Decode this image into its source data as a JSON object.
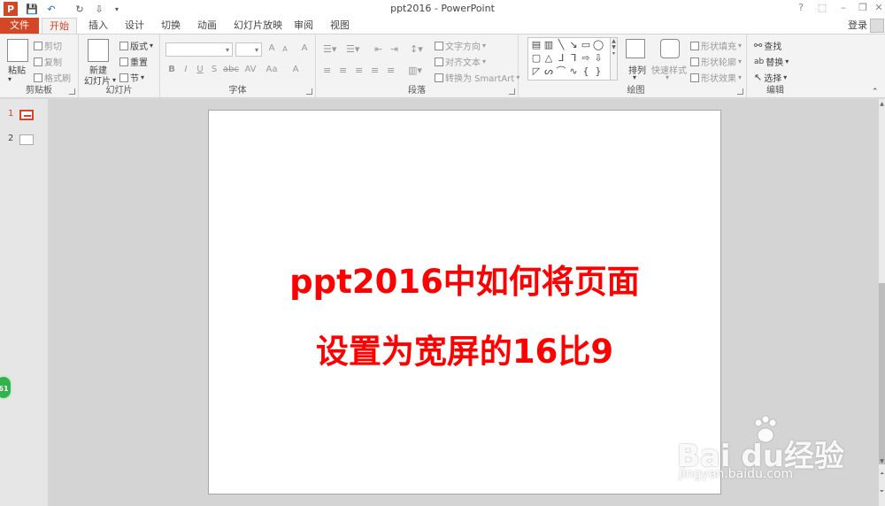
{
  "window": {
    "title": "ppt2016 - PowerPoint",
    "help": "?",
    "minimize": "–",
    "restore": "❐",
    "close": "✕"
  },
  "quick_access": {
    "app_icon": "P",
    "save": "💾",
    "undo": "↶",
    "redo": "↻",
    "more": "⇩"
  },
  "tabs": {
    "file": "文件",
    "items": [
      "开始",
      "插入",
      "设计",
      "切换",
      "动画",
      "幻灯片放映",
      "审阅",
      "视图"
    ],
    "login": "登录"
  },
  "ribbon": {
    "clipboard": {
      "label": "剪贴板",
      "paste": "粘贴",
      "cut": "剪切",
      "copy": "复制",
      "format_painter": "格式刷"
    },
    "slides": {
      "label": "幻灯片",
      "new_slide_1": "新建",
      "new_slide_2": "幻灯片",
      "layout": "版式",
      "reset": "重置",
      "section": "节"
    },
    "font": {
      "label": "字体",
      "bold": "B",
      "italic": "I",
      "underline": "U",
      "shadow": "S",
      "strike": "abc",
      "spacing": "AV",
      "case": "Aa",
      "grow": "A",
      "shrink": "A",
      "clear": "A",
      "color": "A"
    },
    "paragraph": {
      "label": "段落",
      "text_direction": "文字方向",
      "align_text": "对齐文本",
      "convert_smartart": "转换为 SmartArt"
    },
    "drawing": {
      "label": "绘图",
      "arrange": "排列",
      "quick_styles": "快速样式",
      "shape_fill": "形状填充",
      "shape_outline": "形状轮廓",
      "shape_effects": "形状效果"
    },
    "editing": {
      "label": "编辑",
      "find": "查找",
      "replace": "替换",
      "select": "选择"
    }
  },
  "thumbnails": [
    {
      "number": "1",
      "selected": true
    },
    {
      "number": "2",
      "selected": false
    }
  ],
  "slide": {
    "line1": "ppt2016中如何将页面",
    "line2": "设置为宽屏的16比9",
    "text_color": "#ff0000"
  },
  "floating_badge": "61",
  "watermark": {
    "brand": "Bai du经验",
    "url": "jingyan.baidu.com"
  },
  "colors": {
    "accent": "#d24726",
    "ribbon_bg": "#f3f3f3",
    "workspace_bg": "#d4d4d4"
  }
}
